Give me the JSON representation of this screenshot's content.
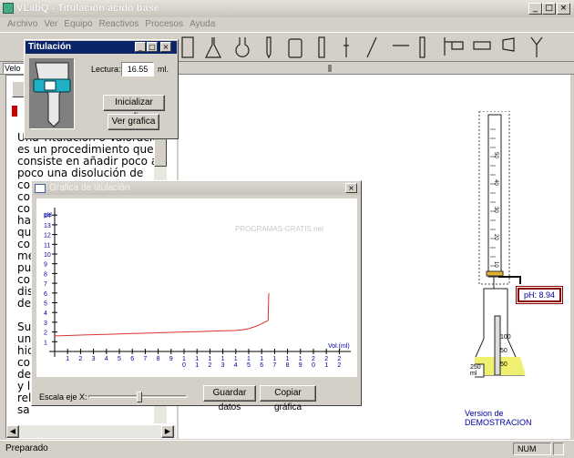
{
  "app": {
    "title": "VLabQ - Titulación ácido base"
  },
  "menu": [
    "Archivo",
    "Ver",
    "Equipo",
    "Reactivos",
    "Procesos",
    "Ayuda"
  ],
  "tabs": {
    "left": "Velo"
  },
  "titulacion": {
    "title": "Titulación",
    "lectura_label": "Lectura:",
    "lectura_value": "16.55",
    "unit": "ml.",
    "init_btn": "Inicializar grafica",
    "view_btn": "Ver grafica"
  },
  "text": {
    "lines": [
      "Una Titulación o Valoración",
      "es un procedimiento que",
      "consiste en añadir poco a",
      "poco una disolución de",
      "co",
      "co",
      "co",
      "ha",
      "qu",
      "co",
      "me",
      "pu",
      "co",
      "dis",
      "de",
      "",
      "Su",
      "un",
      "hic",
      "co",
      "de",
      "y l",
      "rel",
      "sa"
    ]
  },
  "graph": {
    "title": "Grafica de titulación",
    "y_label": "pH",
    "x_label": "Vol.(ml)",
    "scale_label": "Escala eje X:",
    "save_btn": "Guardar datos",
    "copy_btn": "Copiar gráfica",
    "watermark": "PROGRAMAS-GRATIS.net",
    "y_ticks": [
      "14",
      "13",
      "12",
      "11",
      "10",
      "9",
      "8",
      "7",
      "6",
      "5",
      "4",
      "3",
      "2",
      "1"
    ],
    "x_ticks": [
      "1",
      "2",
      "3",
      "4",
      "5",
      "6",
      "7",
      "8",
      "9",
      "1\n0",
      "1\n1",
      "1\n2",
      "1\n3",
      "1\n4",
      "1\n5",
      "1\n6",
      "1\n7",
      "1\n8",
      "1\n9",
      "2\n0",
      "2\n1",
      "2\n2"
    ]
  },
  "apparatus": {
    "ph_label": "pH: 8.94",
    "flask_volume": "250\nml",
    "burette_marks": [
      "50",
      "40",
      "30",
      "20",
      "10"
    ],
    "flask_marks": [
      "100",
      "50",
      "50"
    ]
  },
  "demo_text": "Version de DEMOSTRACION",
  "status": {
    "left": "Preparado",
    "num": "NUM"
  },
  "colors": {
    "curve": "#e03030",
    "axis_text": "#0000a0",
    "ph_border": "#8b0000",
    "solution": "#f0f070"
  }
}
